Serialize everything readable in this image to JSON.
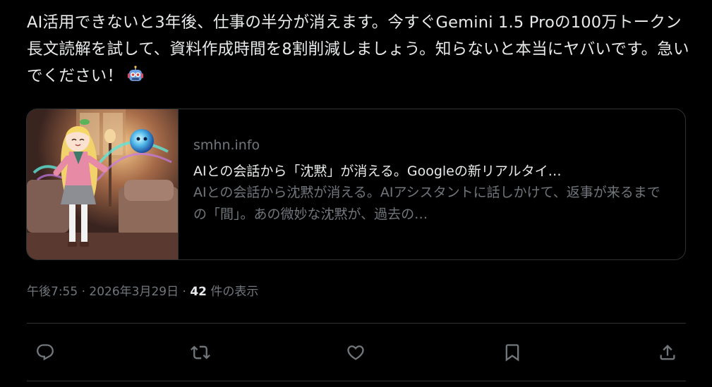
{
  "post": {
    "text": "AI活用できないと3年後、仕事の半分が消えます。今すぐGemini 1.5 Proの100万トークン長文読解を試して、資料作成時間を8割削減しましょう。知らないと本当にヤバいです。急いでください！",
    "emoji_icon": "robot-face-emoji"
  },
  "card": {
    "domain": "smhn.info",
    "title": "AIとの会話から「沈黙」が消える。Googleの新リアルタイ…",
    "description": "AIとの会話から沈黙が消える。AIアシスタントに話しかけて、返事が来るまでの「間」。あの微妙な沈黙が、過去の…",
    "image_icon": "anime-girl-thumbnail"
  },
  "meta": {
    "time": "午後7:55",
    "separator1": " · ",
    "date": "2026年3月29日",
    "separator2": " · ",
    "views_count": "42",
    "views_label": " 件の表示"
  },
  "actions": {
    "reply_icon": "reply-icon",
    "repost_icon": "repost-icon",
    "like_icon": "heart-icon",
    "bookmark_icon": "bookmark-icon",
    "share_icon": "share-icon"
  },
  "colors": {
    "background": "#000000",
    "text_primary": "#e7e9ea",
    "text_secondary": "#71767b",
    "border": "#2f3336"
  }
}
